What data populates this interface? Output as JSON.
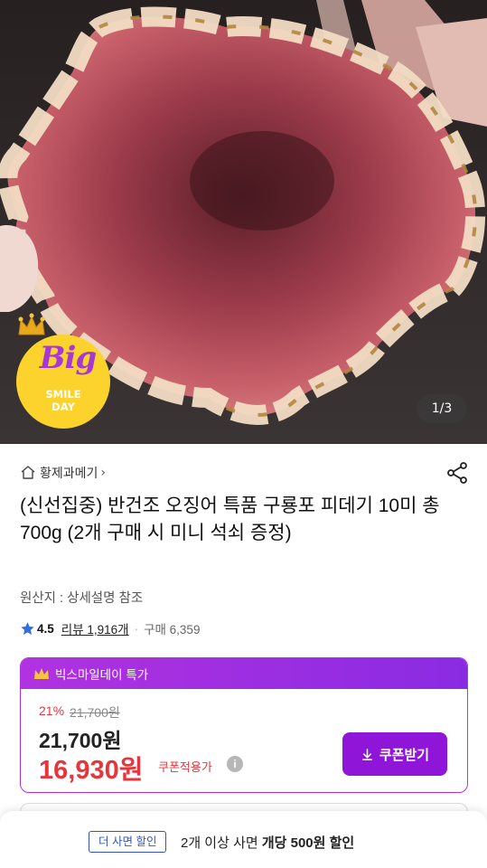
{
  "hero": {
    "image_alt": "grilled squid",
    "counter": "1/3",
    "badge": {
      "line1": "Big",
      "line2": "SMILE",
      "line3": "DAY"
    }
  },
  "store": {
    "name": "황제과메기",
    "chevron": "›"
  },
  "product": {
    "title": "(신선집중) 반건조 오징어 특품 구룡포 피데기 10미 총 700g (2개 구매 시 미니 석쇠 증정)",
    "origin": "원산지 : 상세설명 참조"
  },
  "rating": {
    "score": "4.5",
    "review_label": "리뷰 1,916개",
    "separator": "·",
    "purchase_label": "구매 6,359"
  },
  "price": {
    "header": "빅스마일데이 특가",
    "discount_rate": "21%",
    "original": "21,700원",
    "sale": "21,700원",
    "coupon_price": "16,930원",
    "coupon_applied_label": "쿠폰적용가",
    "info_glyph": "i",
    "coupon_button": "쿠폰받기",
    "colors": {
      "accent": "#8f16d8",
      "discount": "#e8343c"
    }
  },
  "bottom_bar": {
    "tag": "더 사면 할인",
    "text_normal": "2개 이상 사면 ",
    "text_bold": "개당 500원 할인"
  },
  "icons": [
    "home-icon",
    "share-icon",
    "star-icon",
    "crown-icon",
    "download-icon",
    "info-icon"
  ]
}
